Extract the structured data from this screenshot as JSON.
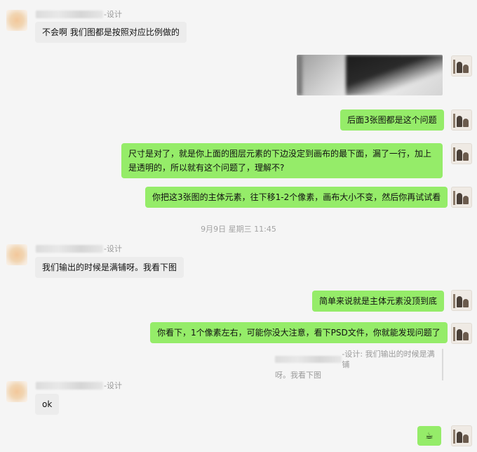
{
  "chat": {
    "sender_suffix": "-设计",
    "time_divider": "9月9日 星期三 11:45",
    "messages": {
      "m1": "不会啊 我们图都是按照对应比例做的",
      "m2": "后面3张图都是这个问题",
      "m3": "尺寸是对了，就是你上面的图层元素的下边没定到画布的最下面，漏了一行，加上是透明的，所以就有这个问题了，理解不?",
      "m4": "你把这3张图的主体元素，往下移1-2个像素，画布大小不变，然后你再试试看",
      "m5": "我们输出的时候是满铺呀。我看下图",
      "m6": "简单来说就是主体元素没顶到底",
      "m7": "你看下，1个像素左右，可能你没大注意，看下PSD文件，你就能发现问题了",
      "m8": "ok"
    },
    "quote": {
      "line1_suffix": "-设计: 我们输出的时候是满铺",
      "line2": "呀。我看下图"
    },
    "emoji": "☕"
  }
}
